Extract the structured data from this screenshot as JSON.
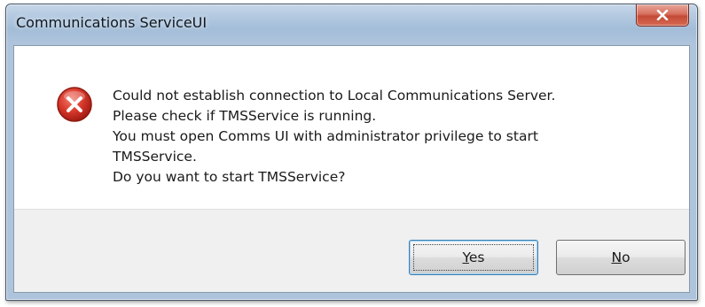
{
  "window": {
    "title": "Communications ServiceUI",
    "close_icon": "close-icon"
  },
  "dialog": {
    "icon": "error-icon",
    "message_lines": [
      "Could not establish connection to Local Communications Server.",
      "Please check if TMSService is running.",
      "You must open Comms UI with administrator privilege to start",
      "TMSService.",
      "Do you want to start TMSService?"
    ]
  },
  "buttons": {
    "yes": {
      "access_key": "Y",
      "rest": "es",
      "label": "Yes"
    },
    "no": {
      "access_key": "N",
      "rest": "o",
      "label": "No"
    }
  },
  "colors": {
    "error_red": "#d8392b",
    "close_button": "#c44a36",
    "focus_border": "#3c7fb1"
  }
}
